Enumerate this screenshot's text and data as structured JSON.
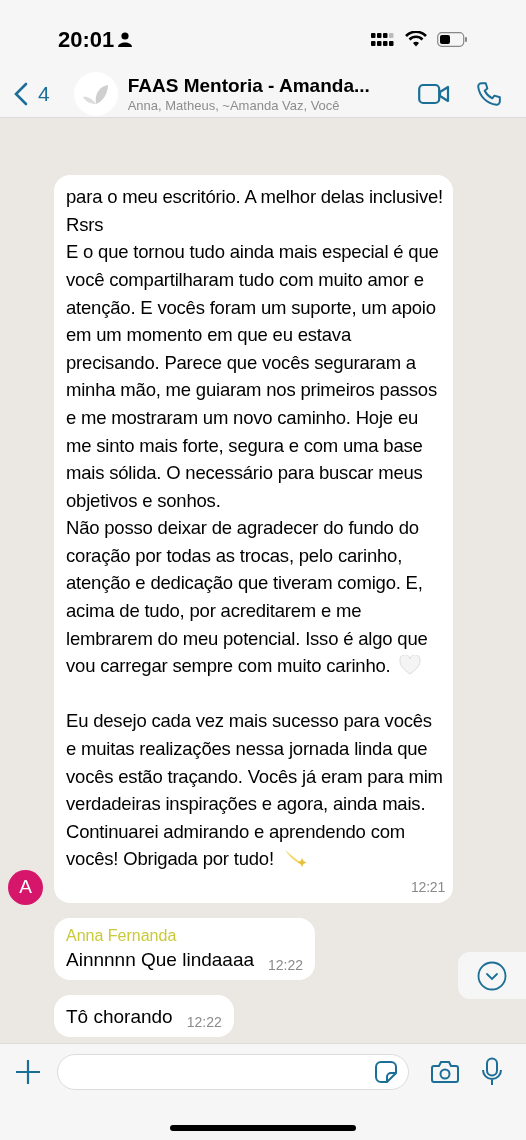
{
  "status_bar": {
    "time": "20:01"
  },
  "header": {
    "back_count": "4",
    "title": "FAAS Mentoria - Amanda...",
    "subtitle": "Anna, Matheus, ~Amanda Vaz, Você"
  },
  "messages": [
    {
      "kind": "long",
      "avatar": "A",
      "paragraphs": [
        {
          "kind": "plain",
          "text": "para o meu escritório. A melhor delas inclusive! Rsrs"
        },
        {
          "kind": "plain",
          "text": "E o que tornou tudo ainda mais especial é que você compartilharam tudo com muito amor e atenção. E vocês foram um suporte, um apoio em um momento em que eu estava precisando. Parece que vocês seguraram a minha mão, me guiaram nos primeiros passos e me mostraram um novo caminho. Hoje eu me sinto mais forte, segura e com uma base mais sólida. O necessário para buscar meus objetivos e sonhos."
        },
        {
          "kind": "heart",
          "text": "Não posso deixar de agradecer do fundo do coração por todas as trocas, pelo carinho, atenção e dedicação que tiveram comigo. E, acima de tudo, por acreditarem e me lembrarem do meu potencial. Isso é algo que vou carregar sempre com muito carinho."
        },
        {
          "kind": "sparkle",
          "spaced": true,
          "text": "Eu desejo cada vez mais sucesso para vocês e muitas realizações nessa jornada linda que vocês estão traçando. Vocês já eram para mim verdadeiras inspirações e agora, ainda mais. Continuarei admirando e aprendendo com vocês! Obrigada por tudo!"
        }
      ],
      "time": "12:21"
    },
    {
      "kind": "short",
      "sender": "Anna Fernanda",
      "color": "#c9c93a",
      "text": "Ainnnnn Que lindaaaa",
      "time": "12:22"
    },
    {
      "kind": "short",
      "text": "Tô chorando",
      "time": "12:22"
    }
  ]
}
